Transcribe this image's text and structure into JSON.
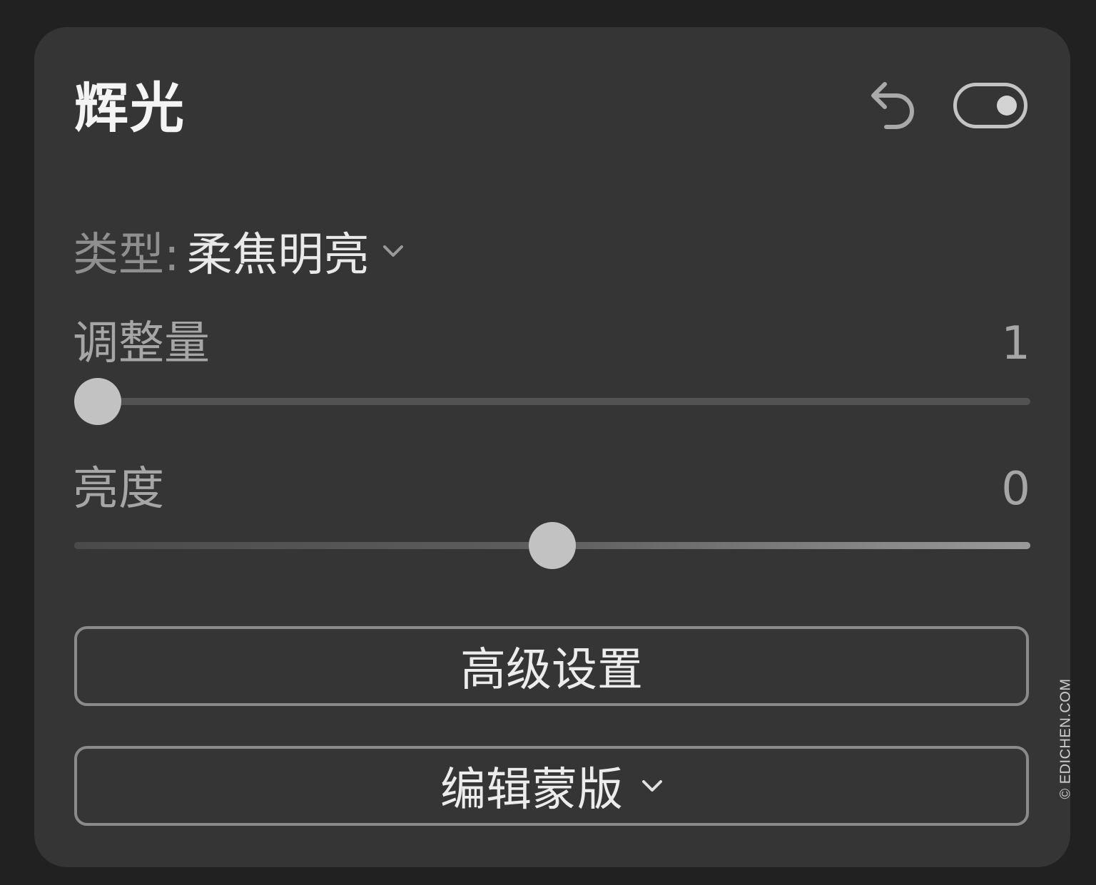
{
  "panel": {
    "title": "辉光",
    "header_icons": [
      "undo-icon",
      "toggle-switch"
    ],
    "toggle_on": true
  },
  "type_selector": {
    "label": "类型:",
    "value": "柔焦明亮"
  },
  "sliders": [
    {
      "label": "调整量",
      "value": "1",
      "position": 0.0
    },
    {
      "label": "亮度",
      "value": "0",
      "position": 0.5
    }
  ],
  "buttons": {
    "advanced": "高级设置",
    "edit_mask": "编辑蒙版"
  },
  "watermark": "© EDICHEN.COM"
}
